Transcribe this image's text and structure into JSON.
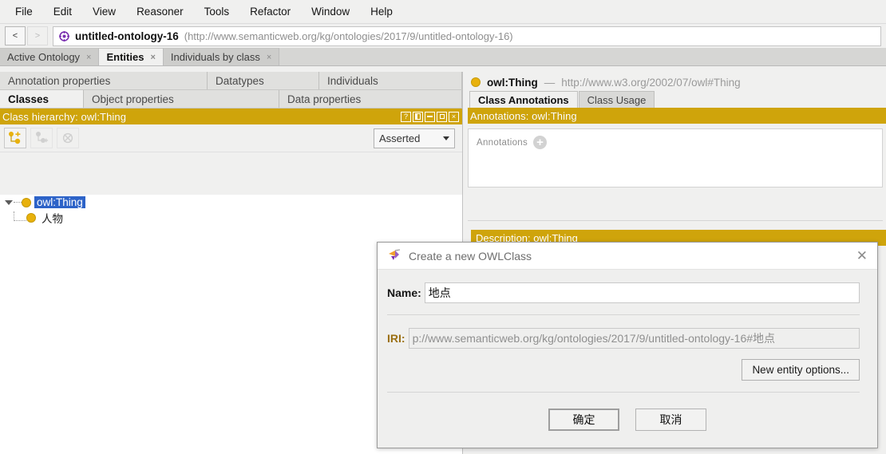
{
  "menu": {
    "items": [
      {
        "label": "File"
      },
      {
        "label": "Edit"
      },
      {
        "label": "View"
      },
      {
        "label": "Reasoner"
      },
      {
        "label": "Tools"
      },
      {
        "label": "Refactor"
      },
      {
        "label": "Window"
      },
      {
        "label": "Help"
      }
    ]
  },
  "toolbar": {
    "back_label": "<",
    "forward_label": ">",
    "ontology_icon": "ontology-icon",
    "ontology_name": "untitled-ontology-16",
    "ontology_iri": "(http://www.semanticweb.org/kg/ontologies/2017/9/untitled-ontology-16)"
  },
  "tabs": [
    {
      "label": "Active Ontology",
      "close": "×",
      "active": false
    },
    {
      "label": "Entities",
      "close": "×",
      "active": true
    },
    {
      "label": "Individuals by class",
      "close": "×",
      "active": false
    }
  ],
  "left_pane": {
    "top_tabs": [
      {
        "label": "Annotation properties"
      },
      {
        "label": "Datatypes"
      },
      {
        "label": "Individuals"
      }
    ],
    "bottom_tabs": [
      {
        "label": "Classes",
        "active": true
      },
      {
        "label": "Object properties",
        "active": false
      },
      {
        "label": "Data properties",
        "active": false
      }
    ],
    "panel_title": "Class hierarchy: owl:Thing",
    "header_buttons": [
      "help-icon",
      "split-icon",
      "minimize-icon",
      "maximize-icon",
      "close-icon"
    ],
    "tree_toolbar": [
      {
        "name": "add-subclass-button",
        "enabled": true
      },
      {
        "name": "add-sibling-class-button",
        "enabled": false
      },
      {
        "name": "delete-class-button",
        "enabled": false
      }
    ],
    "view_selector": {
      "value": "Asserted"
    },
    "tree": {
      "root": {
        "label": "owl:Thing",
        "selected": true
      },
      "children": [
        {
          "label": "人物",
          "selected": false
        }
      ]
    }
  },
  "right_pane": {
    "entity_name": "owl:Thing",
    "entity_separator": "—",
    "entity_iri": "http://www.w3.org/2002/07/owl#Thing",
    "tabs": [
      {
        "label": "Class Annotations",
        "active": true
      },
      {
        "label": "Class Usage",
        "active": false
      }
    ],
    "annotations_header": "Annotations: owl:Thing",
    "annotations_label": "Annotations",
    "add_annotation_icon": "plus-icon",
    "description_header": "Description: owl:Thing"
  },
  "dialog": {
    "icon": "protege-logo-icon",
    "title": "Create a new OWLClass",
    "close_label": "✕",
    "name_label": "Name:",
    "name_value": "地点",
    "iri_label": "IRI:",
    "iri_value": "p://www.semanticweb.org/kg/ontologies/2017/9/untitled-ontology-16#地点",
    "new_entity_options_label": "New entity options...",
    "ok_label": "确定",
    "cancel_label": "取消"
  },
  "colors": {
    "gold": "#cfa40b",
    "selection_blue": "#2d63c8",
    "class_dot": "#e8b10c"
  }
}
